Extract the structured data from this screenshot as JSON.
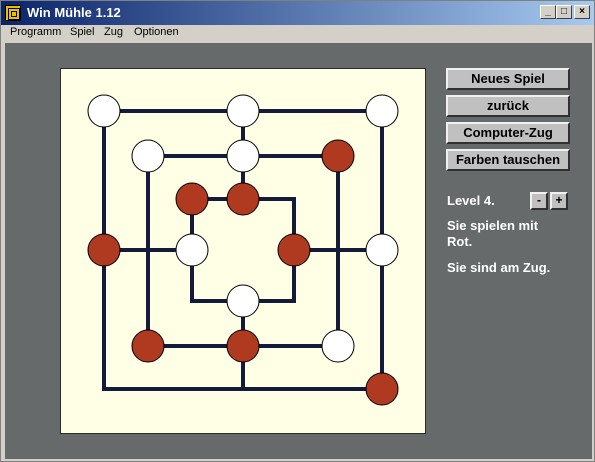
{
  "window": {
    "title": "Win Mühle 1.12",
    "controls": {
      "minimize": "_",
      "maximize": "□",
      "close": "×"
    }
  },
  "menu": [
    "Programm",
    "Spiel",
    "Zug",
    "Optionen"
  ],
  "buttons": {
    "new_game": "Neues Spiel",
    "undo": "zurück",
    "computer_move": "Computer-Zug",
    "swap_colors": "Farben tauschen"
  },
  "level": {
    "label": "Level 4.",
    "minus": "-",
    "plus": "+"
  },
  "status": {
    "line1": "Sie spielen mit",
    "line2": "Rot.",
    "turn": "Sie sind am Zug."
  },
  "colors": {
    "red_piece": "#b03a20",
    "white_piece": "#ffffff",
    "board": "#ffffe6",
    "lines": "#141a3a",
    "background": "#666a6b"
  },
  "board": {
    "positions": [
      {
        "id": "a7",
        "piece": "white"
      },
      {
        "id": "d7",
        "piece": "white"
      },
      {
        "id": "g7",
        "piece": "white"
      },
      {
        "id": "b6",
        "piece": "white"
      },
      {
        "id": "d6",
        "piece": "white"
      },
      {
        "id": "f6",
        "piece": "red"
      },
      {
        "id": "c5",
        "piece": "red"
      },
      {
        "id": "d5",
        "piece": "red"
      },
      {
        "id": "e5",
        "piece": "empty"
      },
      {
        "id": "a4",
        "piece": "red"
      },
      {
        "id": "b4",
        "piece": "empty"
      },
      {
        "id": "c4",
        "piece": "white"
      },
      {
        "id": "e4",
        "piece": "red"
      },
      {
        "id": "f4",
        "piece": "empty"
      },
      {
        "id": "g4",
        "piece": "white"
      },
      {
        "id": "c3",
        "piece": "empty"
      },
      {
        "id": "d3",
        "piece": "white"
      },
      {
        "id": "e3",
        "piece": "empty"
      },
      {
        "id": "b2",
        "piece": "red"
      },
      {
        "id": "d2",
        "piece": "red"
      },
      {
        "id": "f2",
        "piece": "white"
      },
      {
        "id": "a1",
        "piece": "empty"
      },
      {
        "id": "d1",
        "piece": "empty"
      },
      {
        "id": "g1",
        "piece": "red"
      }
    ]
  }
}
